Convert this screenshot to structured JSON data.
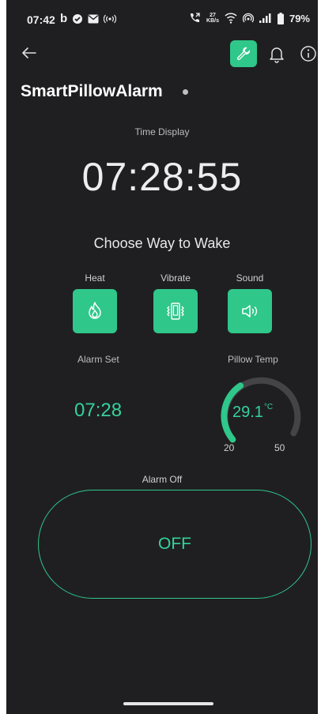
{
  "status_bar": {
    "time": "07:42",
    "left_icons": [
      "b-icon",
      "check-circle-icon",
      "mail-icon",
      "hotspot-icon"
    ],
    "net_speed_value": "27",
    "net_speed_unit": "KB/s",
    "battery": "79%"
  },
  "app_bar": {
    "title": "SmartPillowAlarm"
  },
  "time_display": {
    "label": "Time Display",
    "value": "07:28:55"
  },
  "wake": {
    "title": "Choose Way to Wake",
    "options": [
      {
        "label": "Heat",
        "icon": "flame-icon"
      },
      {
        "label": "Vibrate",
        "icon": "vibrate-icon"
      },
      {
        "label": "Sound",
        "icon": "speaker-icon"
      }
    ]
  },
  "alarm_set": {
    "label": "Alarm Set",
    "value": "07:28"
  },
  "pillow_temp": {
    "label": "Pillow Temp",
    "value": "29.1",
    "unit": "°C",
    "min": "20",
    "max": "50"
  },
  "alarm_off": {
    "label": "Alarm Off",
    "button_label": "OFF"
  },
  "colors": {
    "accent": "#2fc78a",
    "background": "#1f1f21",
    "gauge_track": "#444446"
  }
}
